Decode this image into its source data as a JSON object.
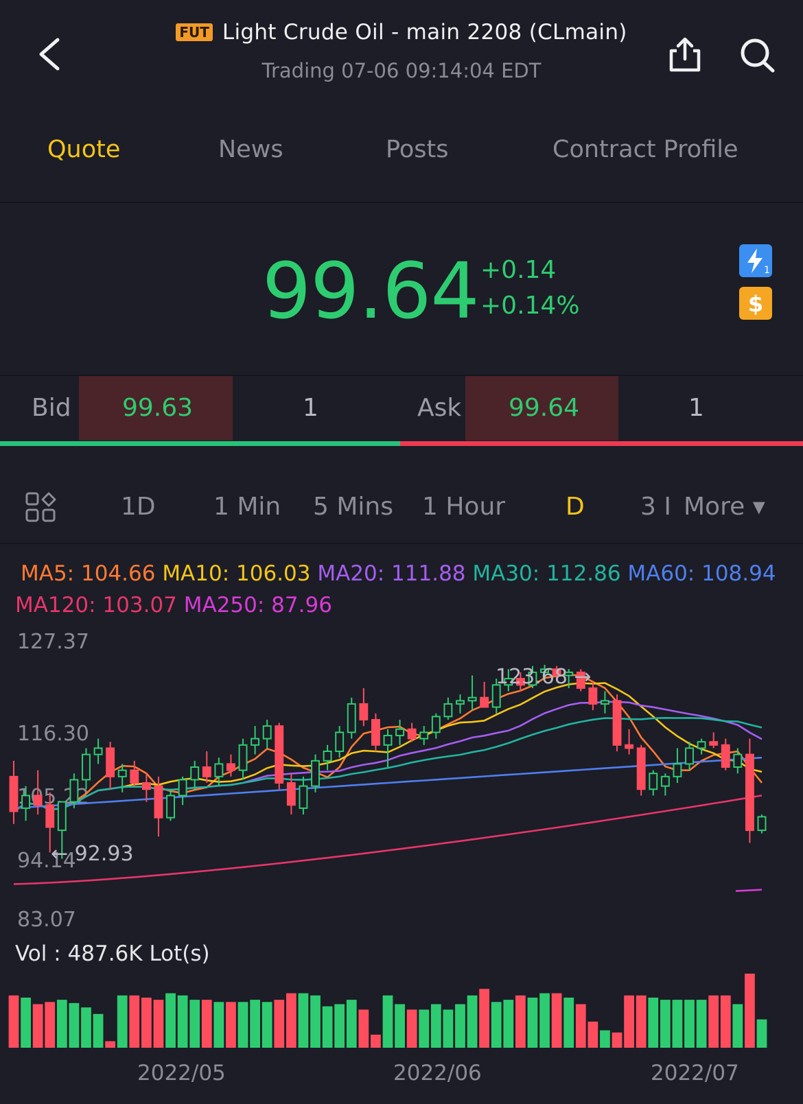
{
  "header": {
    "badge": "FUT",
    "title": "Light  Crude Oil - main 2208 (CLmain)",
    "subtitle": "Trading 07-06 09:14:04 EDT"
  },
  "tabs": [
    {
      "label": "Quote",
      "active": true
    },
    {
      "label": "News",
      "active": false
    },
    {
      "label": "Posts",
      "active": false
    },
    {
      "label": "Contract Profile",
      "active": false
    }
  ],
  "quote": {
    "price": "99.64",
    "change": "+0.14",
    "change_pct": "+0.14%",
    "color": "#2ecc71"
  },
  "bidask": {
    "bid_label": "Bid",
    "bid_price": "99.63",
    "bid_size": "1",
    "ask_label": "Ask",
    "ask_price": "99.64",
    "ask_size": "1"
  },
  "period_tabs": [
    {
      "label": "1D",
      "active": false
    },
    {
      "label": "1 Min",
      "active": false
    },
    {
      "label": "5 Mins",
      "active": false
    },
    {
      "label": "1 Hour",
      "active": false
    },
    {
      "label": "D",
      "active": true
    },
    {
      "label": "3 I",
      "active": false
    },
    {
      "label": "More ▾",
      "active": false
    }
  ],
  "ma": {
    "ma5": "MA5: 104.66",
    "ma10": "MA10: 106.03",
    "ma20": "MA20: 111.88",
    "ma30": "MA30: 112.86",
    "ma60": "MA60: 108.94",
    "ma120": "MA120: 103.07",
    "ma250": "MA250: 87.96"
  },
  "colors": {
    "ma5": "#ff7a33",
    "ma10": "#f5c518",
    "ma20": "#a45ef2",
    "ma30": "#22b4a0",
    "ma60": "#4f7ff0",
    "ma120": "#e8356a",
    "ma250": "#d63bd6",
    "up": "#2ecc71",
    "down": "#ff4d5e"
  },
  "chart_data": {
    "type": "candlestick",
    "y_axis_labels": [
      "127.37",
      "116.30",
      "105.22",
      "94.14",
      "83.07"
    ],
    "ylim": [
      83.07,
      127.37
    ],
    "annotations": {
      "high": "123.68",
      "low": "92.93"
    },
    "x_labels": [
      "2022/05",
      "2022/06",
      "2022/07"
    ],
    "volume_label": "Vol  : 487.6K Lot(s)",
    "candles": [
      {
        "o": 106.0,
        "h": 108.5,
        "l": 98.5,
        "c": 100.5
      },
      {
        "o": 101.0,
        "h": 104.5,
        "l": 99.0,
        "c": 103.0
      },
      {
        "o": 103.0,
        "h": 107.0,
        "l": 100.0,
        "c": 101.5
      },
      {
        "o": 101.5,
        "h": 103.5,
        "l": 94.0,
        "c": 98.0
      },
      {
        "o": 97.5,
        "h": 102.0,
        "l": 93.0,
        "c": 102.0
      },
      {
        "o": 102.0,
        "h": 106.5,
        "l": 101.0,
        "c": 105.5
      },
      {
        "o": 105.5,
        "h": 110.5,
        "l": 104.0,
        "c": 109.5
      },
      {
        "o": 109.5,
        "h": 112.0,
        "l": 108.0,
        "c": 110.5
      },
      {
        "o": 110.5,
        "h": 111.5,
        "l": 104.0,
        "c": 106.0
      },
      {
        "o": 106.0,
        "h": 108.0,
        "l": 103.5,
        "c": 107.0
      },
      {
        "o": 107.0,
        "h": 108.5,
        "l": 104.5,
        "c": 105.0
      },
      {
        "o": 105.0,
        "h": 106.5,
        "l": 102.0,
        "c": 104.0
      },
      {
        "o": 104.5,
        "h": 106.0,
        "l": 96.5,
        "c": 99.5
      },
      {
        "o": 99.5,
        "h": 104.0,
        "l": 99.0,
        "c": 103.0
      },
      {
        "o": 103.0,
        "h": 106.0,
        "l": 101.5,
        "c": 105.5
      },
      {
        "o": 105.5,
        "h": 108.5,
        "l": 104.0,
        "c": 107.5
      },
      {
        "o": 107.5,
        "h": 110.0,
        "l": 105.0,
        "c": 106.0
      },
      {
        "o": 106.0,
        "h": 109.0,
        "l": 104.5,
        "c": 108.0
      },
      {
        "o": 108.0,
        "h": 109.5,
        "l": 106.0,
        "c": 107.0
      },
      {
        "o": 107.0,
        "h": 112.0,
        "l": 105.5,
        "c": 111.0
      },
      {
        "o": 111.0,
        "h": 114.0,
        "l": 109.5,
        "c": 112.0
      },
      {
        "o": 112.0,
        "h": 115.0,
        "l": 110.5,
        "c": 114.0
      },
      {
        "o": 114.0,
        "h": 114.5,
        "l": 104.0,
        "c": 105.0
      },
      {
        "o": 105.0,
        "h": 106.5,
        "l": 100.0,
        "c": 101.5
      },
      {
        "o": 101.0,
        "h": 106.0,
        "l": 100.0,
        "c": 104.5
      },
      {
        "o": 104.5,
        "h": 109.5,
        "l": 103.5,
        "c": 108.5
      },
      {
        "o": 108.5,
        "h": 111.0,
        "l": 107.0,
        "c": 110.0
      },
      {
        "o": 110.0,
        "h": 114.0,
        "l": 109.0,
        "c": 113.0
      },
      {
        "o": 113.0,
        "h": 118.5,
        "l": 112.0,
        "c": 117.5
      },
      {
        "o": 117.5,
        "h": 120.0,
        "l": 114.0,
        "c": 115.0
      },
      {
        "o": 115.0,
        "h": 116.0,
        "l": 110.0,
        "c": 111.0
      },
      {
        "o": 111.0,
        "h": 113.5,
        "l": 107.5,
        "c": 112.5
      },
      {
        "o": 112.5,
        "h": 115.0,
        "l": 111.0,
        "c": 113.5
      },
      {
        "o": 113.5,
        "h": 114.5,
        "l": 111.5,
        "c": 112.0
      },
      {
        "o": 112.0,
        "h": 114.0,
        "l": 111.0,
        "c": 113.0
      },
      {
        "o": 113.0,
        "h": 116.0,
        "l": 112.0,
        "c": 115.5
      },
      {
        "o": 115.5,
        "h": 118.5,
        "l": 115.0,
        "c": 117.5
      },
      {
        "o": 117.5,
        "h": 119.0,
        "l": 116.0,
        "c": 118.0
      },
      {
        "o": 118.0,
        "h": 122.0,
        "l": 116.5,
        "c": 118.5
      },
      {
        "o": 118.5,
        "h": 121.0,
        "l": 117.0,
        "c": 117.0
      },
      {
        "o": 117.0,
        "h": 121.5,
        "l": 116.0,
        "c": 120.5
      },
      {
        "o": 120.5,
        "h": 123.0,
        "l": 119.5,
        "c": 121.5
      },
      {
        "o": 121.5,
        "h": 122.5,
        "l": 119.5,
        "c": 120.5
      },
      {
        "o": 120.5,
        "h": 123.5,
        "l": 120.0,
        "c": 122.5
      },
      {
        "o": 122.5,
        "h": 123.68,
        "l": 121.5,
        "c": 123.0
      },
      {
        "o": 123.0,
        "h": 123.5,
        "l": 121.5,
        "c": 122.0
      },
      {
        "o": 122.0,
        "h": 123.0,
        "l": 120.0,
        "c": 122.5
      },
      {
        "o": 122.5,
        "h": 123.0,
        "l": 119.5,
        "c": 120.0
      },
      {
        "o": 120.0,
        "h": 121.0,
        "l": 116.5,
        "c": 117.5
      },
      {
        "o": 117.5,
        "h": 119.5,
        "l": 116.0,
        "c": 118.0
      },
      {
        "o": 118.0,
        "h": 119.0,
        "l": 110.0,
        "c": 111.0
      },
      {
        "o": 111.0,
        "h": 113.5,
        "l": 109.5,
        "c": 110.5
      },
      {
        "o": 110.5,
        "h": 111.0,
        "l": 103.0,
        "c": 104.0
      },
      {
        "o": 104.0,
        "h": 107.0,
        "l": 103.0,
        "c": 106.5
      },
      {
        "o": 104.5,
        "h": 106.5,
        "l": 103.0,
        "c": 106.0
      },
      {
        "o": 106.0,
        "h": 110.5,
        "l": 105.0,
        "c": 108.0
      },
      {
        "o": 108.0,
        "h": 111.5,
        "l": 107.0,
        "c": 110.5
      },
      {
        "o": 110.5,
        "h": 112.0,
        "l": 109.5,
        "c": 111.5
      },
      {
        "o": 111.5,
        "h": 113.0,
        "l": 110.5,
        "c": 111.0
      },
      {
        "o": 111.0,
        "h": 112.0,
        "l": 107.0,
        "c": 107.5
      },
      {
        "o": 107.5,
        "h": 110.5,
        "l": 106.5,
        "c": 109.5
      },
      {
        "o": 109.5,
        "h": 112.0,
        "l": 95.5,
        "c": 97.5
      },
      {
        "o": 97.5,
        "h": 100.0,
        "l": 97.0,
        "c": 99.64
      }
    ],
    "volumes": [
      48,
      46,
      40,
      42,
      44,
      41,
      37,
      31,
      6,
      48,
      48,
      46,
      44,
      50,
      48,
      44,
      44,
      42,
      42,
      42,
      44,
      42,
      44,
      50,
      50,
      48,
      38,
      40,
      44,
      35,
      12,
      48,
      40,
      35,
      35,
      40,
      35,
      40,
      48,
      54,
      42,
      44,
      48,
      46,
      50,
      50,
      46,
      40,
      24,
      16,
      14,
      48,
      48,
      46,
      44,
      44,
      44,
      44,
      48,
      48,
      40,
      68,
      26
    ]
  }
}
